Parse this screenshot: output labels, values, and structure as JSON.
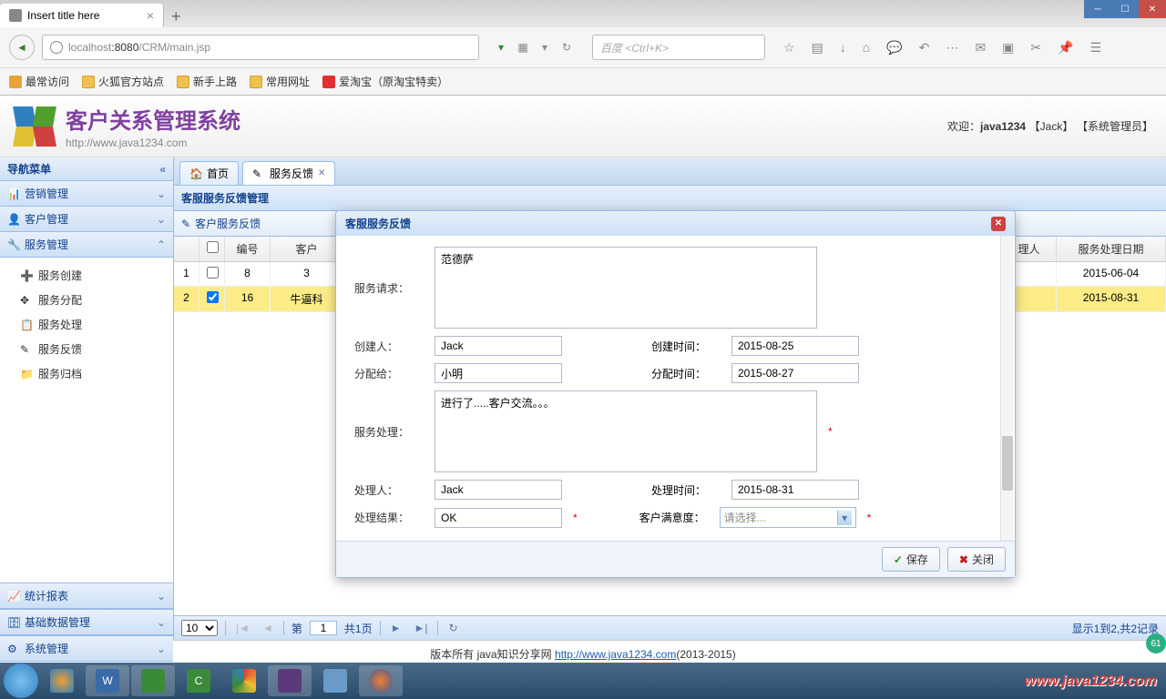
{
  "browser": {
    "tab_title": "Insert title here",
    "url_gray1": "localhost",
    "url_host": ":8080",
    "url_path": "/CRM/main.jsp",
    "search_placeholder": "百度 <Ctrl+K>"
  },
  "bookmarks": [
    "最常访问",
    "火狐官方站点",
    "新手上路",
    "常用网址",
    "爱淘宝（原淘宝特卖）"
  ],
  "app": {
    "title": "客户关系管理系统",
    "subtitle": "http://www.java1234.com",
    "welcome_prefix": "欢迎：",
    "welcome_user": "java1234",
    "welcome_role1": "【Jack】",
    "welcome_role2": "【系统管理员】"
  },
  "sidebar": {
    "title": "导航菜单",
    "groups": [
      {
        "label": "营销管理"
      },
      {
        "label": "客户管理"
      },
      {
        "label": "服务管理",
        "expanded": true,
        "items": [
          "服务创建",
          "服务分配",
          "服务处理",
          "服务反馈",
          "服务归档"
        ]
      },
      {
        "label": "统计报表"
      },
      {
        "label": "基础数据管理"
      },
      {
        "label": "系统管理"
      }
    ]
  },
  "tabs": {
    "home": "首页",
    "active": "服务反馈"
  },
  "panel": {
    "title": "客服服务反馈管理",
    "subtitle": "客户服务反馈"
  },
  "grid": {
    "headers": {
      "num": "编号",
      "cust": "客户",
      "person": "人",
      "date": "服务处理日期"
    },
    "rows": [
      {
        "n": "1",
        "chk": false,
        "id": "8",
        "cust": "3",
        "date": "2015-06-04"
      },
      {
        "n": "2",
        "chk": true,
        "id": "16",
        "cust": "牛逼科",
        "date": "2015-08-31"
      }
    ]
  },
  "pager": {
    "size": "10",
    "page": "1",
    "total": "共1页",
    "info": "显示1到2,共2记录",
    "di": "第"
  },
  "dialog": {
    "title": "客服服务反馈",
    "labels": {
      "serviceReq": "服务请求：",
      "creator": "创建人：",
      "createTime": "创建时间：",
      "assignTo": "分配给：",
      "assignTime": "分配时间：",
      "serviceProc": "服务处理：",
      "handler": "处理人：",
      "handleTime": "处理时间：",
      "result": "处理结果：",
      "satisfy": "客户满意度："
    },
    "values": {
      "serviceReq": "范德萨",
      "creator": "Jack",
      "createTime": "2015-08-25",
      "assignTo": "小明",
      "assignTime": "2015-08-27",
      "serviceProc": "进行了.....客户交流。。。",
      "handler": "Jack",
      "handleTime": "2015-08-31",
      "result": "OK",
      "satisfy": "请选择..."
    },
    "buttons": {
      "save": "保存",
      "close": "关闭"
    }
  },
  "footer": {
    "text": "版本所有 java知识分享网 ",
    "link": "http://www.java1234.com",
    "suffix": "(2013-2015)"
  },
  "watermark": "www.java1234.com",
  "notif": "61"
}
